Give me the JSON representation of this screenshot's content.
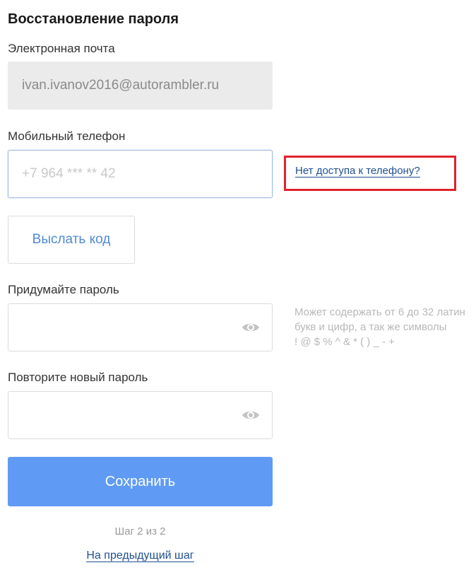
{
  "page": {
    "title": "Восстановление пароля"
  },
  "email": {
    "label": "Электронная почта",
    "value": "ivan.ivanov2016@autorambler.ru"
  },
  "phone": {
    "label": "Мобильный телефон",
    "placeholder": "+7 964 *** ** 42",
    "no_access_link": "Нет доступа к телефону?"
  },
  "send_code": {
    "label": "Выслать код"
  },
  "new_password": {
    "label": "Придумайте пароль",
    "hint_lines": [
      "Может содержать от 6 до 32 латин",
      "букв и цифр, а так же символы",
      "! @ $ % ^ & * ( ) _ - +"
    ]
  },
  "repeat_password": {
    "label": "Повторите новый пароль"
  },
  "save": {
    "label": "Сохранить"
  },
  "footer": {
    "step": "Шаг 2 из 2",
    "prev_step_link": "На предыдущий шаг"
  },
  "icons": {
    "password_toggle": "eye-icon"
  },
  "colors": {
    "primary": "#5f9bf4",
    "link": "#1f4f8f",
    "highlight": "#e0222c",
    "send_code_text": "#4f8ad6"
  }
}
